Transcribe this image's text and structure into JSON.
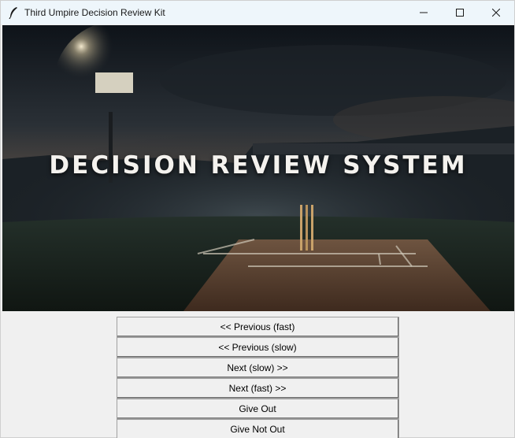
{
  "window": {
    "title": "Third Umpire Decision Review Kit",
    "app_icon": "feather-icon",
    "controls": [
      "minimize-icon",
      "maximize-icon",
      "close-icon"
    ]
  },
  "banner": {
    "headline": "DECISION REVIEW SYSTEM",
    "scene": "cricket-stadium-night-pitch-stumps"
  },
  "buttons": {
    "prev_fast": "<< Previous (fast)",
    "prev_slow": "<< Previous (slow)",
    "next_slow": "Next (slow) >>",
    "next_fast": "Next (fast) >>",
    "give_out": "Give Out",
    "give_not_out": "Give Not Out"
  },
  "colors": {
    "titlebar": "#eef6fb",
    "window_bg": "#f0f0f0",
    "banner_text": "#f4f2ee"
  }
}
